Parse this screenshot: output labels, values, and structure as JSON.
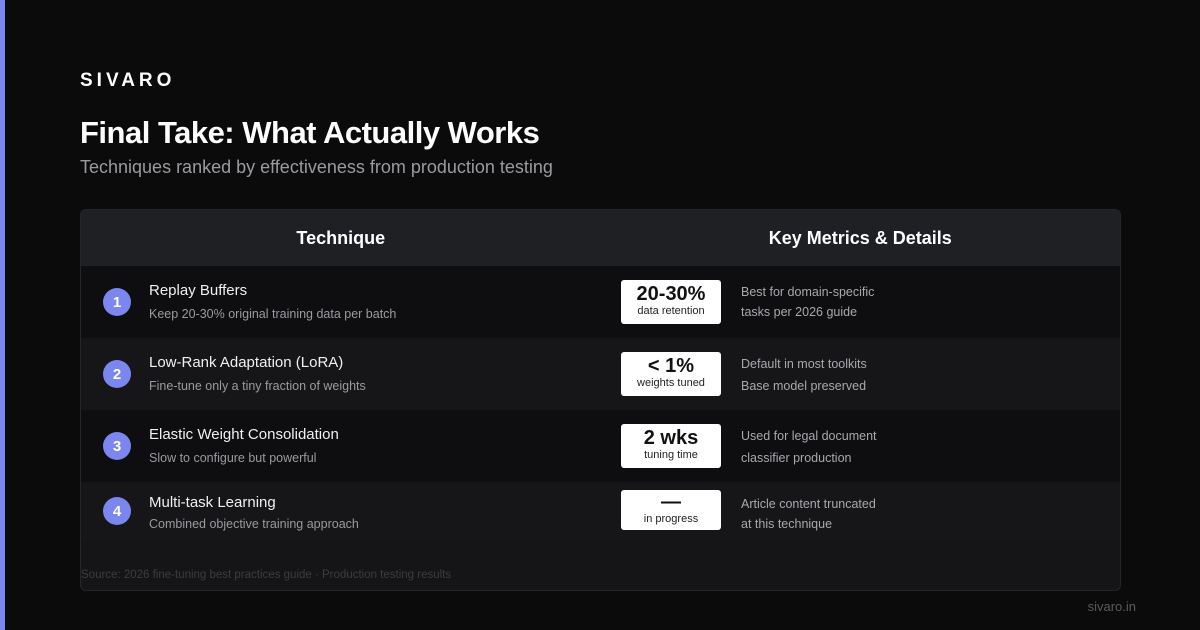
{
  "brand": "SIVARO",
  "title": "Final Take: What Actually Works",
  "subtitle": "Techniques ranked by effectiveness from production testing",
  "table": {
    "headers": [
      "Technique",
      "Key Metrics & Details"
    ],
    "rows": [
      {
        "rank": "1",
        "name": "Replay Buffers",
        "description": "Keep 20-30% original training data per batch",
        "metric_value": "20-30%",
        "metric_label": "data retention",
        "detail_line1": "Best for domain-specific",
        "detail_line2": "tasks per 2026 guide"
      },
      {
        "rank": "2",
        "name": "Low-Rank Adaptation (LoRA)",
        "description": "Fine-tune only a tiny fraction of weights",
        "metric_value": "< 1%",
        "metric_label": "weights tuned",
        "detail_line1": "Default in most toolkits",
        "detail_line2": "Base model preserved"
      },
      {
        "rank": "3",
        "name": "Elastic Weight Consolidation",
        "description": "Slow to configure but powerful",
        "metric_value": "2 wks",
        "metric_label": "tuning time",
        "detail_line1": "Used for legal document",
        "detail_line2": "classifier production"
      },
      {
        "rank": "4",
        "name": "Multi-task Learning",
        "description": "Combined objective training approach",
        "metric_value": "—",
        "metric_label": "in progress",
        "detail_line1": "Article content truncated",
        "detail_line2": "at this technique"
      }
    ]
  },
  "source": "Source: 2026 fine-tuning best practices guide · Production testing results",
  "footer_url": "sivaro.in",
  "colors": {
    "accent": "#7b86ee",
    "background": "#0b0b0b",
    "card": "#151517"
  }
}
